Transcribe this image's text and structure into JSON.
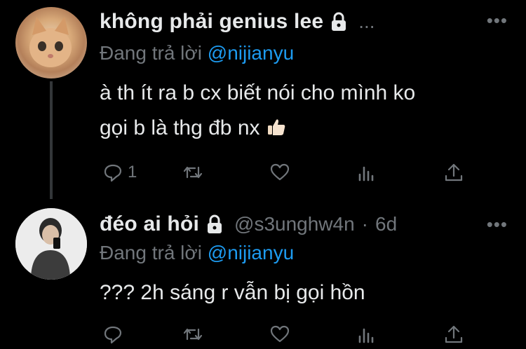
{
  "tweets": [
    {
      "name": "không phải genius lee",
      "handle_trail": "...",
      "replying_prefix": "Đang trả lời ",
      "replying_mention": "@nijianyu",
      "text_line1": "à th ít ra b cx biết nói cho mình ko",
      "text_line2": "gọi b là thg đb nx",
      "reply_count": "1",
      "more": "•••"
    },
    {
      "name": "đéo ai hỏi",
      "handle": "@s3unghw4n",
      "dot": "·",
      "time": "6d",
      "replying_prefix": "Đang trả lời ",
      "replying_mention": "@nijianyu",
      "text_line1": "??? 2h sáng r vẫn bị gọi hồn",
      "more": "•••"
    }
  ],
  "colors": {
    "background": "#000000",
    "text": "#e7e9ea",
    "secondary": "#71767b",
    "mention": "#1d9bf0"
  },
  "icons": [
    "lock-icon",
    "more-icon",
    "reply-icon",
    "retweet-icon",
    "like-icon",
    "views-icon",
    "share-icon",
    "thumbs-up-emoji"
  ]
}
